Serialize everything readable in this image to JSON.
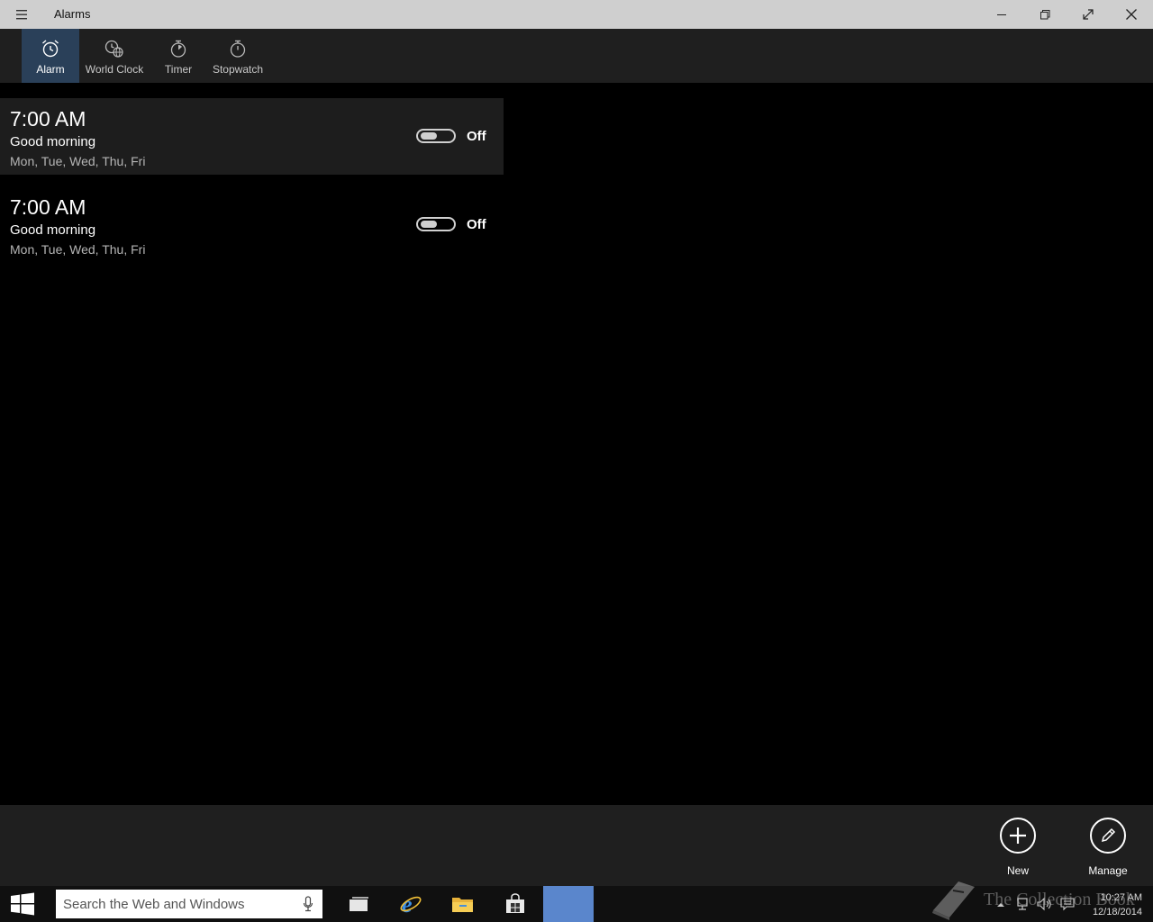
{
  "window": {
    "title": "Alarms",
    "menu_icon": "hamburger-icon",
    "controls": [
      "minimize-icon",
      "restore-icon",
      "fullscreen-icon",
      "close-icon"
    ]
  },
  "tabs": [
    {
      "label": "Alarm",
      "icon": "alarm-clock-icon",
      "active": true
    },
    {
      "label": "World Clock",
      "icon": "world-clock-icon",
      "active": false
    },
    {
      "label": "Timer",
      "icon": "timer-icon",
      "active": false
    },
    {
      "label": "Stopwatch",
      "icon": "stopwatch-icon",
      "active": false
    }
  ],
  "alarms": [
    {
      "time": "7:00 AM",
      "name": "Good morning",
      "days": "Mon, Tue, Wed, Thu, Fri",
      "state": "Off",
      "selected": true
    },
    {
      "time": "7:00 AM",
      "name": "Good morning",
      "days": "Mon, Tue, Wed, Thu, Fri",
      "state": "Off",
      "selected": false
    }
  ],
  "commands": [
    {
      "label": "New",
      "icon": "plus-icon"
    },
    {
      "label": "Manage",
      "icon": "pencil-icon"
    }
  ],
  "taskbar": {
    "search_placeholder": "Search the Web and Windows",
    "time": "10:27 AM",
    "date": "12/18/2014"
  },
  "watermark": "The Collection Book",
  "colors": {
    "titlebar": "#cfcfcf",
    "chrome": "#1f1f1f",
    "active_tab": "#2a4059",
    "taskbar_active": "#5a86cc"
  }
}
